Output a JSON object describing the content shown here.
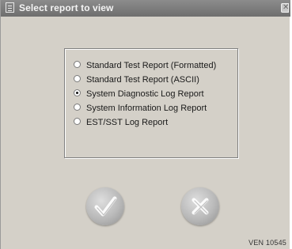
{
  "window": {
    "title": "Select report to view",
    "close_icon_glyph": "✕",
    "title_icon": "document-icon"
  },
  "report_options": [
    {
      "label": "Standard Test Report (Formatted)",
      "selected": false
    },
    {
      "label": "Standard Test Report (ASCII)",
      "selected": false
    },
    {
      "label": "System Diagnostic Log Report",
      "selected": true
    },
    {
      "label": "System Information Log Report",
      "selected": false
    },
    {
      "label": "EST/SST Log Report",
      "selected": false
    }
  ],
  "buttons": {
    "ok_icon": "check-icon",
    "cancel_icon": "x-icon"
  },
  "footer": {
    "code": "VEN 10545"
  }
}
